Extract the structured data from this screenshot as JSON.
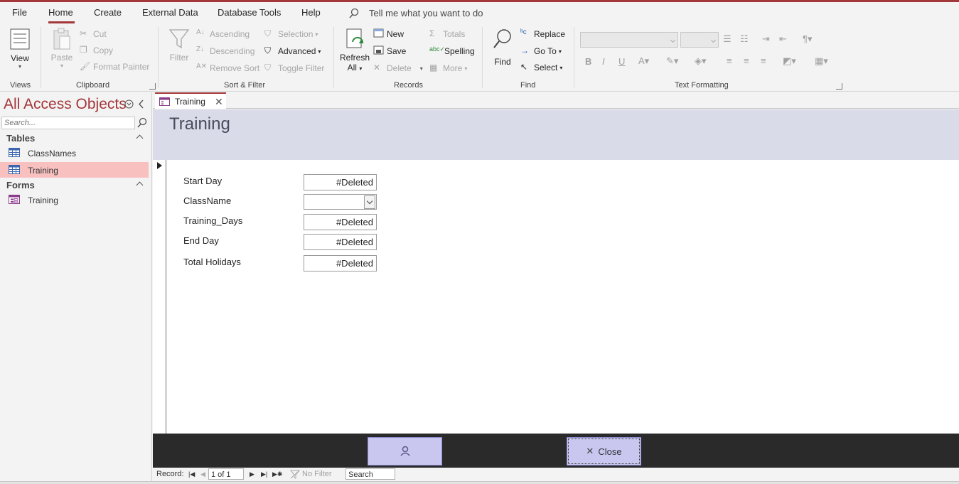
{
  "menu": {
    "tabs": [
      "File",
      "Home",
      "Create",
      "External Data",
      "Database Tools",
      "Help"
    ],
    "active": "Home",
    "tell_me": "Tell me what you want to do"
  },
  "ribbon": {
    "views": {
      "view": "View",
      "label": "Views"
    },
    "clipboard": {
      "paste": "Paste",
      "cut": "Cut",
      "copy": "Copy",
      "format_painter": "Format Painter",
      "label": "Clipboard"
    },
    "sort_filter": {
      "filter": "Filter",
      "ascending": "Ascending",
      "descending": "Descending",
      "remove_sort": "Remove Sort",
      "selection": "Selection",
      "advanced": "Advanced",
      "toggle_filter": "Toggle Filter",
      "label": "Sort & Filter"
    },
    "records": {
      "refresh": "Refresh",
      "refresh_all": "All",
      "new": "New",
      "save": "Save",
      "delete": "Delete",
      "totals": "Totals",
      "spelling": "Spelling",
      "more": "More",
      "label": "Records"
    },
    "find": {
      "find": "Find",
      "replace": "Replace",
      "goto": "Go To",
      "select": "Select",
      "label": "Find"
    },
    "text_formatting": {
      "label": "Text Formatting",
      "bold": "B",
      "italic": "I",
      "underline": "U"
    }
  },
  "nav": {
    "title": "All Access Objects",
    "search_placeholder": "Search...",
    "sections": [
      {
        "title": "Tables",
        "items": [
          {
            "label": "ClassNames"
          },
          {
            "label": "Training",
            "selected": true
          }
        ]
      },
      {
        "title": "Forms",
        "items": [
          {
            "label": "Training"
          }
        ]
      }
    ]
  },
  "document": {
    "tab": "Training",
    "form_title": "Training",
    "fields": [
      {
        "label": "Start Day",
        "value": "#Deleted",
        "type": "text"
      },
      {
        "label": "ClassName",
        "value": "",
        "type": "combo"
      },
      {
        "label": "Training_Days",
        "value": "#Deleted",
        "type": "text"
      },
      {
        "label": "End Day",
        "value": "#Deleted",
        "type": "text"
      },
      {
        "label": "Total Holidays",
        "value": "#Deleted",
        "type": "text"
      }
    ],
    "buttons": {
      "close": "Close"
    }
  },
  "record_nav": {
    "label": "Record:",
    "position": "1 of 1",
    "filter": "No Filter",
    "search": "Search"
  },
  "colors": {
    "accent": "#a4373a",
    "form_header": "#d9dbe9",
    "button": "#c9c7f0",
    "selected_item": "#f9c0c0"
  }
}
